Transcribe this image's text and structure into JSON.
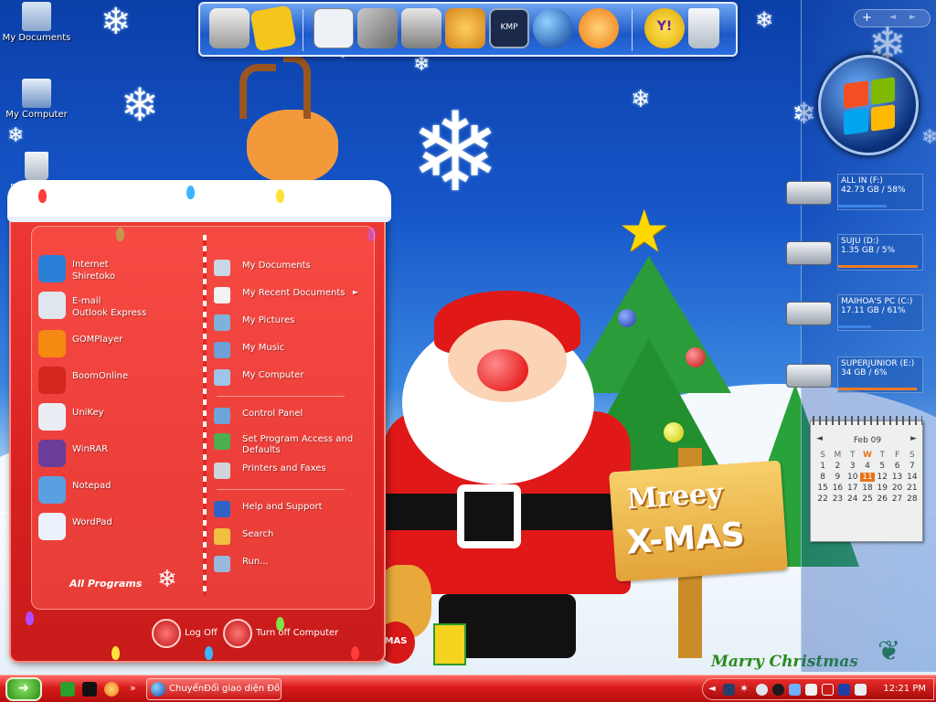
{
  "desktop_icons": [
    {
      "label": "My Documents",
      "icon": "folder-documents-icon"
    },
    {
      "label": "My Computer",
      "icon": "computer-icon"
    },
    {
      "label": "Recycle Bin",
      "icon": "recycle-bin-icon"
    }
  ],
  "dock": {
    "items": [
      "system-icon",
      "dictionary-icon",
      "unikey-icon",
      "tools-icon",
      "camera-icon",
      "paint-icon",
      "kmp-player-icon",
      "globe-icon",
      "gom-player-icon",
      "yahoo-messenger-icon",
      "recycle-bin-icon"
    ],
    "kmp_label": "KMP",
    "yahoo_label": "Y!"
  },
  "sidebar": {
    "top_controls": [
      "+",
      "◄",
      "►"
    ],
    "drives": [
      {
        "name": "ALL IN (F:)",
        "info": "42.73 GB / 58%",
        "fill": 0.58,
        "bar_color": "#3a85e6"
      },
      {
        "name": "SUJU (D:)",
        "info": "1.35 GB / 5%",
        "fill": 0.95,
        "bar_color": "#f07a24"
      },
      {
        "name": "MAIHOA'S PC (C:)",
        "info": "17.11 GB / 61%",
        "fill": 0.39,
        "bar_color": "#3a85e6"
      },
      {
        "name": "SUPERJUNIOR (E:)",
        "info": "34 GB / 6%",
        "fill": 0.94,
        "bar_color": "#f07a24"
      }
    ]
  },
  "calendar": {
    "month": "Feb 09",
    "weekdays": [
      "S",
      "M",
      "T",
      "W",
      "T",
      "F",
      "S"
    ],
    "weeks": [
      [
        "1",
        "2",
        "3",
        "4",
        "5",
        "6",
        "7"
      ],
      [
        "8",
        "9",
        "10",
        "11",
        "12",
        "13",
        "14"
      ],
      [
        "15",
        "16",
        "17",
        "18",
        "19",
        "20",
        "21"
      ],
      [
        "22",
        "23",
        "24",
        "25",
        "26",
        "27",
        "28"
      ]
    ],
    "today": "11"
  },
  "scene": {
    "sign_line1": "Mreey",
    "sign_line2": "X-MAS",
    "greeting": "Marry Christmas",
    "bag_text": "MAS"
  },
  "start_menu": {
    "pinned": [
      {
        "label": "Internet\nShiretoko",
        "icon": "internet-browser-icon",
        "color": "#2a7fd6"
      },
      {
        "label": "E-mail\nOutlook Express",
        "icon": "email-icon",
        "color": "#dfe6ee"
      },
      {
        "label": "GOMPlayer",
        "icon": "gom-player-icon",
        "color": "#f58a12"
      },
      {
        "label": "BoomOnline",
        "icon": "boomonline-icon",
        "color": "#d4281e"
      },
      {
        "label": "UniKey",
        "icon": "unikey-icon",
        "color": "#e8eef4"
      },
      {
        "label": "WinRAR",
        "icon": "winrar-icon",
        "color": "#6a3d9a"
      },
      {
        "label": "Notepad",
        "icon": "notepad-icon",
        "color": "#5aa0e0"
      },
      {
        "label": "WordPad",
        "icon": "wordpad-icon",
        "color": "#eaf1fb"
      }
    ],
    "all_programs": "All Programs",
    "places": [
      {
        "label": "My Documents",
        "icon": "my-documents-icon",
        "color": "#c9d6e6"
      },
      {
        "label": "My Recent Documents",
        "icon": "recent-documents-icon",
        "color": "#f2f2f2",
        "arrow": "►"
      },
      {
        "label": "My Pictures",
        "icon": "my-pictures-icon",
        "color": "#7fb2d8"
      },
      {
        "label": "My Music",
        "icon": "my-music-icon",
        "color": "#6e9fd6"
      },
      {
        "label": "My Computer",
        "icon": "my-computer-icon",
        "color": "#9ec4ea"
      },
      {
        "label": "Control Panel",
        "icon": "control-panel-icon",
        "color": "#6fa3d9"
      },
      {
        "label": "Set Program Access and\nDefaults",
        "icon": "program-access-icon",
        "color": "#4caf50"
      },
      {
        "label": "Printers and Faxes",
        "icon": "printer-icon",
        "color": "#d0d4da"
      },
      {
        "label": "Help and Support",
        "icon": "help-icon",
        "color": "#2f62c4"
      },
      {
        "label": "Search",
        "icon": "search-icon",
        "color": "#f0c040"
      },
      {
        "label": "Run...",
        "icon": "run-icon",
        "color": "#9ab8dc"
      }
    ],
    "log_off": "Log Off",
    "turn_off": "Turn off Computer"
  },
  "taskbar": {
    "quick_launch": [
      "unikey-quick-icon",
      "media-quick-icon",
      "gom-quick-icon"
    ],
    "more": "»",
    "task_title": "ChuyểnĐổi giao diện Đồ...",
    "tray_icons": [
      "kmp-tray-icon",
      "star-tray-icon",
      "volume-tray-icon",
      "sync-tray-icon",
      "network-tray-icon",
      "shield-tray-icon",
      "security-tray-icon",
      "monitor-tray-icon",
      "language-tray-icon"
    ],
    "tray_arrow": "◄",
    "clock": "12:21 PM"
  }
}
